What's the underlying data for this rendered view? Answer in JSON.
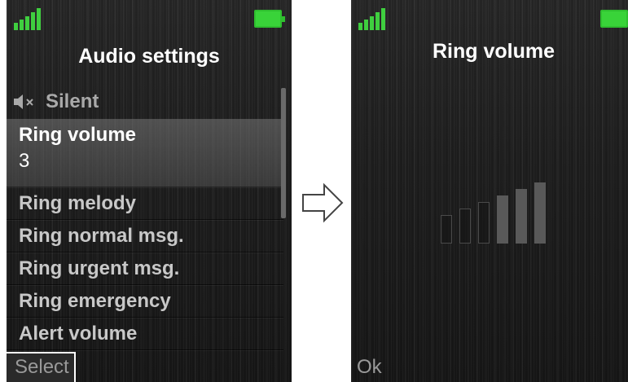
{
  "left_screen": {
    "title": "Audio settings",
    "silent_label": "Silent",
    "menu_items": [
      {
        "label": "Ring volume",
        "value": "3"
      },
      {
        "label": "Ring melody"
      },
      {
        "label": "Ring normal msg."
      },
      {
        "label": "Ring urgent msg."
      },
      {
        "label": "Ring emergency"
      },
      {
        "label": "Alert volume"
      }
    ],
    "softkey_left": "Select"
  },
  "right_screen": {
    "title": "Ring volume",
    "volume_level": 3,
    "volume_steps": 6,
    "softkey_left": "Ok"
  },
  "colors": {
    "battery": "#39d339",
    "signal": "#3fcf3f",
    "volume_on": "#595959",
    "volume_off_border": "#4a4a4a"
  },
  "icons": {
    "signal": "signal-strength-icon",
    "battery": "battery-full-icon",
    "silent": "speaker-muted-icon",
    "arrow": "right-arrow-icon"
  }
}
